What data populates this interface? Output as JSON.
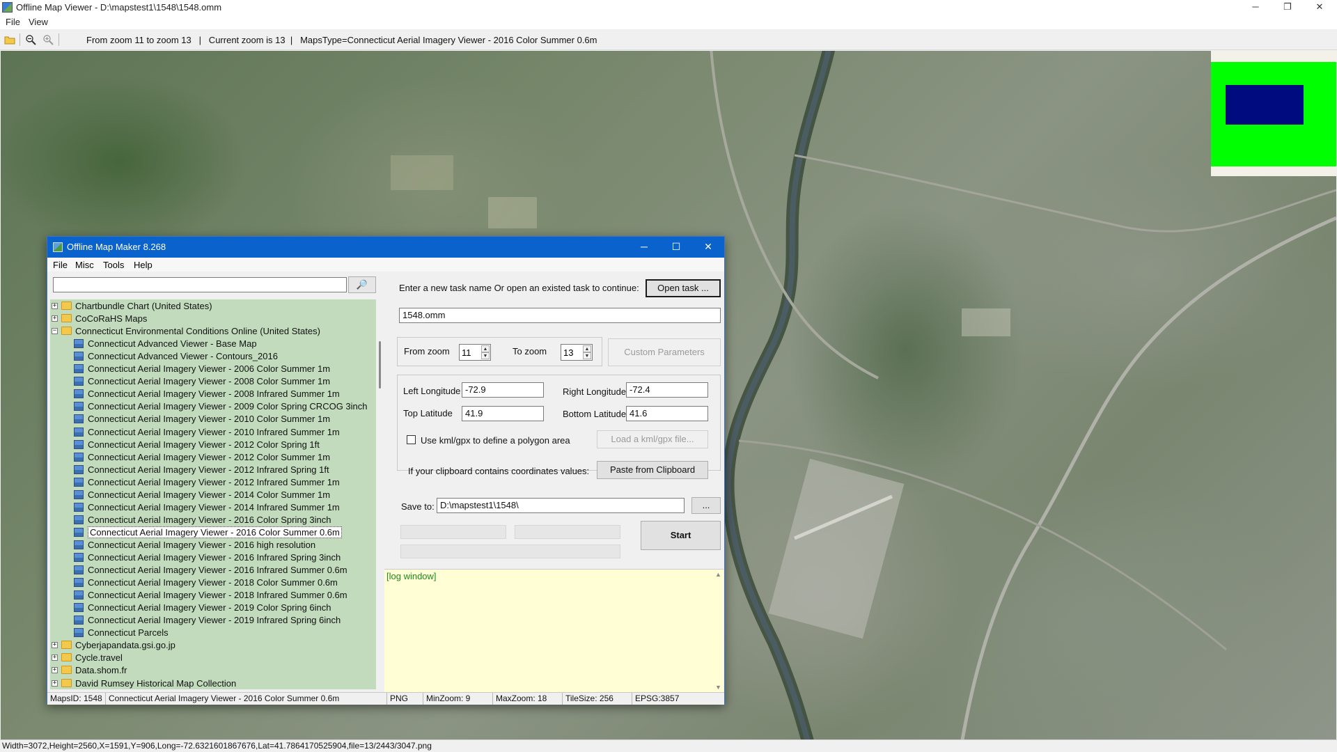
{
  "window": {
    "title": "Offline Map Viewer - D:\\mapstest1\\1548\\1548.omm",
    "controls": {
      "minimize": "─",
      "maximize": "❐",
      "close": "✕"
    }
  },
  "menu": {
    "file": "File",
    "view": "View"
  },
  "toolbar": {
    "info": "From zoom 11 to zoom 13   |   Current zoom is 13  |   MapsType=Connecticut Aerial Imagery Viewer - 2016 Color Summer 0.6m",
    "icons": [
      "open-folder-icon",
      "zoom-out-icon",
      "zoom-in-icon"
    ]
  },
  "minimap": {
    "colors": {
      "background": "#00ff00",
      "viewport": "#000b80"
    }
  },
  "status_bar": {
    "text": "Width=3072,Height=2560,X=1591,Y=906,Long=-72.6321601867676,Lat=41.7864170525904,file=13/2443/3047.png"
  },
  "dialog": {
    "title": "Offline Map Maker 8.268",
    "controls": {
      "minimize": "─",
      "maximize": "☐",
      "close": "✕"
    },
    "menu": [
      "File",
      "Misc",
      "Tools",
      "Help"
    ],
    "search": {
      "value": "",
      "button_icon": "search-icon",
      "button_glyph": "🔎"
    },
    "tree": [
      {
        "level": 0,
        "type": "folder",
        "expander": "+",
        "label": "Chartbundle Chart (United States)"
      },
      {
        "level": 0,
        "type": "folder",
        "expander": "+",
        "label": "CoCoRaHS Maps"
      },
      {
        "level": 0,
        "type": "folder-open",
        "expander": "−",
        "label": "Connecticut Environmental Conditions Online (United States)"
      },
      {
        "level": 1,
        "type": "map",
        "label": "Connecticut Advanced Viewer - Base Map"
      },
      {
        "level": 1,
        "type": "map",
        "label": "Connecticut Advanced Viewer - Contours_2016"
      },
      {
        "level": 1,
        "type": "map",
        "label": "Connecticut Aerial Imagery Viewer - 2006 Color Summer 1m"
      },
      {
        "level": 1,
        "type": "map",
        "label": "Connecticut Aerial Imagery Viewer - 2008 Color Summer 1m"
      },
      {
        "level": 1,
        "type": "map",
        "label": "Connecticut Aerial Imagery Viewer - 2008 Infrared Summer 1m"
      },
      {
        "level": 1,
        "type": "map",
        "label": "Connecticut Aerial Imagery Viewer - 2009 Color Spring CRCOG 3inch"
      },
      {
        "level": 1,
        "type": "map",
        "label": "Connecticut Aerial Imagery Viewer - 2010 Color Summer 1m"
      },
      {
        "level": 1,
        "type": "map",
        "label": "Connecticut Aerial Imagery Viewer - 2010 Infrared Summer 1m"
      },
      {
        "level": 1,
        "type": "map",
        "label": "Connecticut Aerial Imagery Viewer - 2012 Color Spring 1ft"
      },
      {
        "level": 1,
        "type": "map",
        "label": "Connecticut Aerial Imagery Viewer - 2012 Color Summer 1m"
      },
      {
        "level": 1,
        "type": "map",
        "label": "Connecticut Aerial Imagery Viewer - 2012 Infrared Spring 1ft"
      },
      {
        "level": 1,
        "type": "map",
        "label": "Connecticut Aerial Imagery Viewer - 2012 Infrared Summer 1m"
      },
      {
        "level": 1,
        "type": "map",
        "label": "Connecticut Aerial Imagery Viewer - 2014 Color Summer 1m"
      },
      {
        "level": 1,
        "type": "map",
        "label": "Connecticut Aerial Imagery Viewer - 2014 Infrared Summer 1m"
      },
      {
        "level": 1,
        "type": "map",
        "label": "Connecticut Aerial Imagery Viewer - 2016 Color Spring 3inch"
      },
      {
        "level": 1,
        "type": "map",
        "label": "Connecticut Aerial Imagery Viewer - 2016 Color Summer 0.6m",
        "selected": true
      },
      {
        "level": 1,
        "type": "map",
        "label": "Connecticut Aerial Imagery Viewer - 2016 high resolution"
      },
      {
        "level": 1,
        "type": "map",
        "label": "Connecticut Aerial Imagery Viewer - 2016 Infrared Spring 3inch"
      },
      {
        "level": 1,
        "type": "map",
        "label": "Connecticut Aerial Imagery Viewer - 2016 Infrared Summer 0.6m"
      },
      {
        "level": 1,
        "type": "map",
        "label": "Connecticut Aerial Imagery Viewer - 2018 Color Summer 0.6m"
      },
      {
        "level": 1,
        "type": "map",
        "label": "Connecticut Aerial Imagery Viewer - 2018 Infrared Summer 0.6m"
      },
      {
        "level": 1,
        "type": "map",
        "label": "Connecticut Aerial Imagery Viewer - 2019 Color Spring 6inch"
      },
      {
        "level": 1,
        "type": "map",
        "label": "Connecticut Aerial Imagery Viewer - 2019 Infrared Spring 6inch"
      },
      {
        "level": 1,
        "type": "map",
        "label": "Connecticut Parcels"
      },
      {
        "level": 0,
        "type": "folder",
        "expander": "+",
        "label": "Cyberjapandata.gsi.go.jp"
      },
      {
        "level": 0,
        "type": "folder",
        "expander": "+",
        "label": "Cycle.travel"
      },
      {
        "level": 0,
        "type": "folder",
        "expander": "+",
        "label": "Data.shom.fr"
      },
      {
        "level": 0,
        "type": "folder",
        "expander": "+",
        "label": "David Rumsey Historical Map Collection"
      }
    ],
    "task": {
      "prompt": "Enter a new task name Or open an existed task to continue:",
      "open_button": "Open task ...",
      "name_value": "1548.omm"
    },
    "zoom": {
      "from_label": "From zoom",
      "from_value": "11",
      "to_label": "To zoom",
      "to_value": "13",
      "custom_button": "Custom Parameters"
    },
    "coords": {
      "left_lon_label": "Left Longitude",
      "left_lon": "-72.9",
      "right_lon_label": "Right Longitude",
      "right_lon": "-72.4",
      "top_lat_label": "Top Latitude",
      "top_lat": "41.9",
      "bottom_lat_label": "Bottom Latitude",
      "bottom_lat": "41.6"
    },
    "kml": {
      "checkbox_label": "Use kml/gpx to define a polygon area",
      "checked": false,
      "load_button": "Load a kml/gpx file..."
    },
    "clipboard": {
      "label": "If your clipboard contains coordinates values:",
      "button": "Paste from Clipboard"
    },
    "save": {
      "label": "Save to:",
      "value": "D:\\mapstest1\\1548\\",
      "browse_button": "..."
    },
    "start_button": "Start",
    "log": {
      "text": "[log window]",
      "scroll_up": "▲",
      "scroll_down": "▼"
    },
    "status": {
      "maps_id": "MapsID: 1548",
      "map_name": "Connecticut Aerial Imagery Viewer - 2016 Color Summer 0.6m",
      "format": "PNG",
      "min_zoom": "MinZoom: 9",
      "max_zoom": "MaxZoom: 18",
      "tile_size": "TileSize: 256",
      "epsg": "EPSG:3857"
    }
  }
}
